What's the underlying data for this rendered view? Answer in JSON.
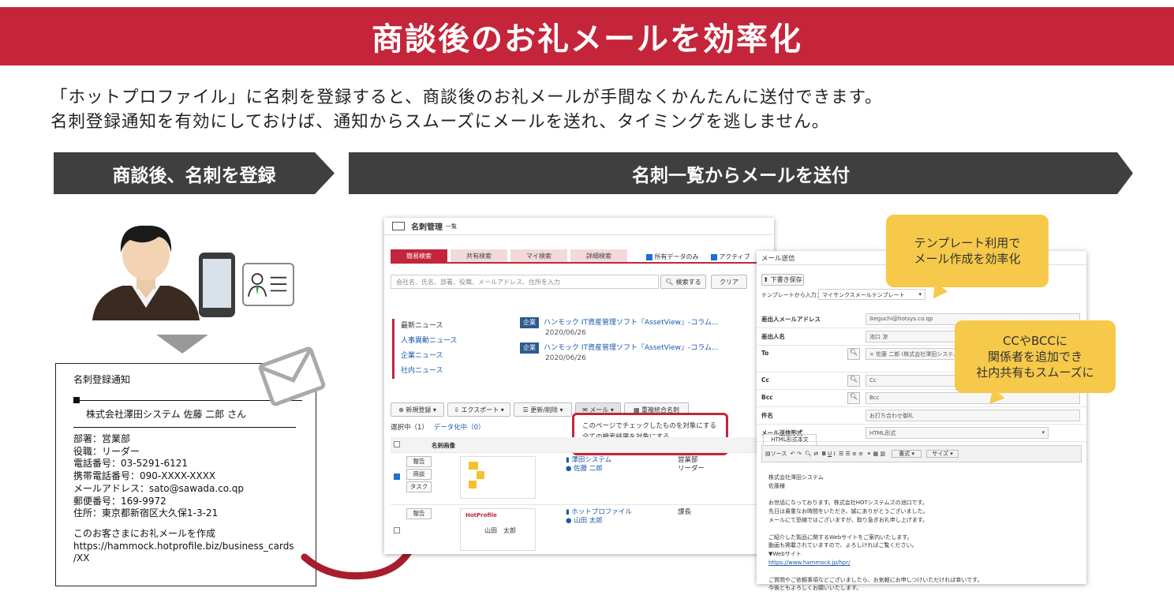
{
  "banner": {
    "title": "商談後のお礼メールを効率化"
  },
  "intro": {
    "line1": "「ホットプロファイル」に名刺を登録すると、商談後のお礼メールが手間なくかんたんに送付できます。",
    "line2": "名刺登録通知を有効にしておけば、通知からスムーズにメールを送れ、タイミングを逃しません。"
  },
  "steps": {
    "step1": "商談後、名刺を登録",
    "step2": "名刺一覧からメールを送付"
  },
  "notice": {
    "title": "名刺登録通知",
    "company_line": "株式会社澤田システム 佐藤 二郎 さん",
    "dept": "部署：営業部",
    "position": "役職：リーダー",
    "tel": "電話番号：03-5291-6121",
    "mobile": "携帯電話番号：090-XXXX-XXXX",
    "email": "メールアドレス：sato@sawada.co.qp",
    "zip": "郵便番号：169-9972",
    "address": "住所：東京都新宿区大久保1-3-21",
    "cta": "このお客さまにお礼メールを作成",
    "url1": "https://hammock.hotprofile.biz/business_cards",
    "url2": "/XX"
  },
  "card_list": {
    "title": "名刺管理",
    "subtitle": "一覧",
    "tabs": [
      "簡易検索",
      "共有検索",
      "マイ検索",
      "詳細検索"
    ],
    "check_all_data": "所有データのみ",
    "check_active": "アクティブ",
    "search_placeholder": "会社名、氏名、部署、役職、メールアドレス、住所を入力",
    "search_button": "検索する",
    "clear_button": "クリア",
    "news_categories": [
      "最新ニュース",
      "人事異動ニュース",
      "企業ニュース",
      "社内ニュース"
    ],
    "news_items": [
      {
        "badge": "企業",
        "text": "ハンモック IT資産管理ソフト『AssetView』-コラム...",
        "date": "2020/06/26"
      },
      {
        "badge": "企業",
        "text": "ハンモック IT資産管理ソフト『AssetView』-コラム...",
        "date": "2020/06/26"
      }
    ],
    "toolbar": {
      "new": "新規登録",
      "export": "エクスポート",
      "update": "更新/削除",
      "mail": "メール",
      "merge": "重複統合名刺"
    },
    "selection": "選択中（1）",
    "data_pending": "データ化中（0）",
    "col_image": "名刺画像",
    "menu": {
      "item1": "このページでチェックしたものを対象にする",
      "item2": "全ての検索結果を対象にする"
    },
    "rows": [
      {
        "btn1": "報告",
        "btn2": "商談",
        "btn3": "タスク",
        "company": "澤田システム",
        "name": "佐藤 二郎",
        "dept": "営業部",
        "position": "リーダー"
      },
      {
        "btn1": "報告",
        "company": "ホットプロファイル",
        "name": "山田 太郎",
        "dept": "",
        "position": "課長",
        "card_name": "山田　太郎",
        "card_brand": "HotProfile"
      }
    ]
  },
  "mail_form": {
    "title": "メール送信",
    "draft_button": "下書き保存",
    "template_label": "テンプレートから入力：",
    "template_value": "マイサンクスメールテンプレート",
    "from_label": "差出人メールアドレス",
    "from_value": "ikeguchi@hotsys.co.qp",
    "from_name_label": "差出人名",
    "from_name_value": "池口 涼",
    "to_label": "To",
    "to_value": "佐藤 二郎 (株式会社澤田システム / sat",
    "cc_label": "Cc",
    "cc_value": "Cc",
    "bcc_label": "Bcc",
    "bcc_value": "Bcc",
    "subject_label": "件名",
    "subject_value": "お打ち合わせ御礼",
    "format_label": "メール送信形式",
    "format_value": "HTML形式",
    "body_tab": "HTML形式本文",
    "editor": {
      "source": "ソース",
      "format": "書式",
      "size": "サイズ"
    },
    "body_lines": [
      "株式会社澤田システム",
      "佐藤様",
      "",
      "お世話になっております。株式会社HOTシステムズの池口です。",
      "先日は貴重なお時間をいただき、誠にありがとうございました。",
      "メールにて恐縮ではございますが、取り急ぎお礼申し上げます。",
      "",
      "ご紹介した製品に関するWebサイトをご案内いたします。",
      "動画も掲載されていますので、よろしければご覧ください。",
      "▼Webサイト",
      "https://www.hammock.jp/hpr/",
      "",
      "ご質問やご依頼事項などございましたら、お気軽にお申しつけいただければ幸いです。",
      "今後ともよろしくお願いいたします。"
    ]
  },
  "callouts": {
    "template": {
      "line1": "テンプレート利用で",
      "line2": "メール作成を効率化"
    },
    "cc": {
      "line1": "CCやBCCに",
      "line2": "関係者を追加でき",
      "line3": "社内共有もスムーズに"
    }
  },
  "colors": {
    "brand_red": "#c4253a",
    "step_dark": "#3f3f3f",
    "callout_yellow": "#f7c94a",
    "link_blue": "#1a5aa8"
  }
}
